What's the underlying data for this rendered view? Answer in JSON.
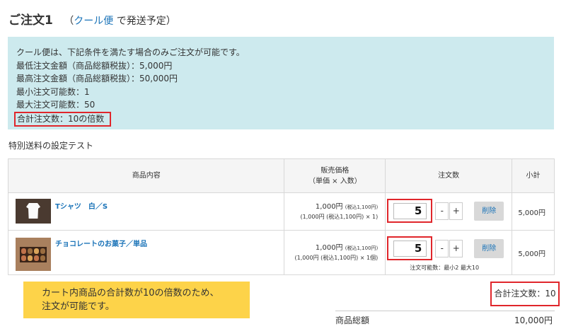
{
  "header": {
    "order_title": "ご注文1",
    "paren_open": "（",
    "shipping_link": "クール便",
    "shipping_suffix": "で発送予定）"
  },
  "notice": {
    "lines": [
      "クール便は、下記条件を満たす場合のみご注文が可能です。",
      "最低注文金額（商品総額税抜）：5,000円",
      "最高注文金額（商品総額税抜）：50,000円",
      "最小注文可能数：1",
      "最大注文可能数：50"
    ],
    "highlight": "合計注文数：10の倍数"
  },
  "section_label": "特別送料の設定テスト",
  "table": {
    "headers": {
      "product": "商品内容",
      "price_line1": "販売価格",
      "price_line2": "（単価 × 入数）",
      "quantity": "注文数",
      "subtotal": "小計"
    },
    "rows": [
      {
        "name": "Tシャツ　白／S",
        "price_main": "1,000円",
        "price_tax": "(税込1,100円)",
        "price_sub": "(1,000円 (税込1,100円) × 1)",
        "qty": "5",
        "minus": "-",
        "plus": "+",
        "delete": "削除",
        "subtotal": "5,000円"
      },
      {
        "name": "チョコレートのお菓子／単品",
        "price_main": "1,000円",
        "price_tax": "(税込1,100円)",
        "price_sub": "(1,000円 (税込1,100円) × 1個)",
        "qty": "5",
        "minus": "-",
        "plus": "+",
        "delete": "削除",
        "note": "注文可能数：最小2 最大10",
        "subtotal": "5,000円"
      }
    ]
  },
  "message": {
    "line1": "カート内商品の合計数が10の倍数のため、",
    "line2": "注文が可能です。"
  },
  "total_qty": "合計注文数：10",
  "summary": {
    "label": "商品総額",
    "value": "10,000円"
  },
  "colors": {
    "notice_bg": "#cdeaee",
    "link": "#1a73b8",
    "highlight_border": "#e0262b",
    "message_bg": "#fdd349"
  }
}
